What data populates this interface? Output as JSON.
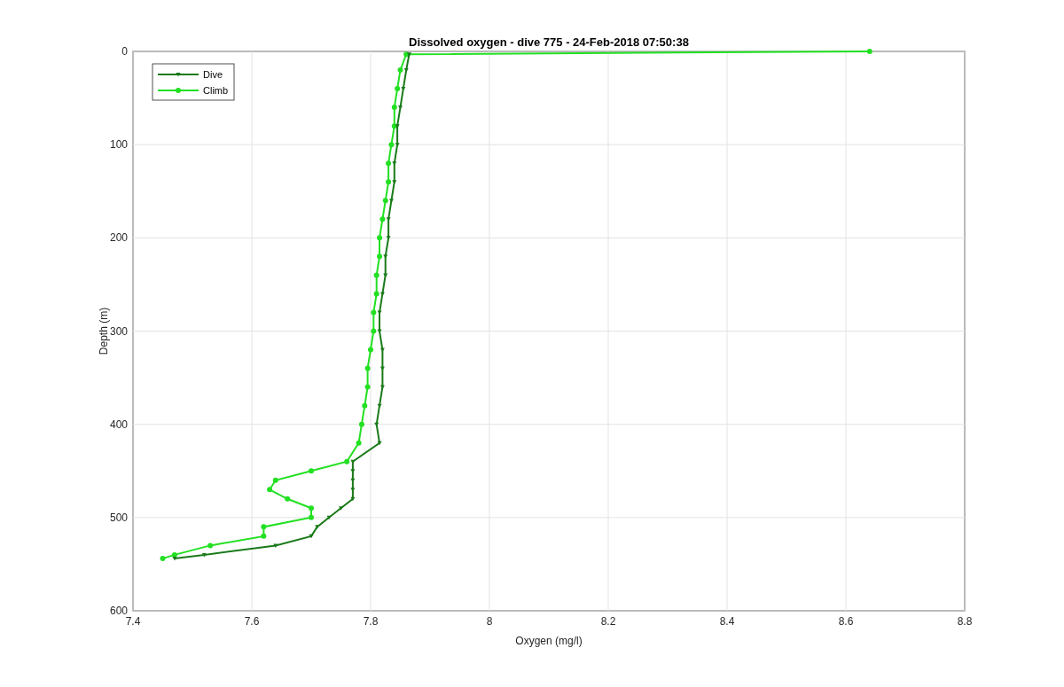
{
  "chart_data": {
    "type": "line",
    "orientation": "horizontal",
    "title": "Dissolved oxygen - dive 775 - 24-Feb-2018 07:50:38",
    "xlabel": "Oxygen (mg/l)",
    "ylabel": "Depth (m)",
    "x": [
      0,
      3,
      20,
      40,
      60,
      80,
      100,
      120,
      140,
      160,
      180,
      200,
      220,
      240,
      260,
      280,
      300,
      320,
      340,
      360,
      380,
      400,
      420,
      440,
      450,
      460,
      470,
      480,
      490,
      500,
      510,
      520,
      530,
      540,
      544
    ],
    "series": [
      {
        "name": "Dive",
        "color": "#1a7a1a",
        "marker": "triangle",
        "values": [
          null,
          7.865,
          7.86,
          7.855,
          7.85,
          7.845,
          7.845,
          7.84,
          7.84,
          7.835,
          7.83,
          7.83,
          7.825,
          7.825,
          7.82,
          7.815,
          7.815,
          7.82,
          7.82,
          7.82,
          7.815,
          7.81,
          7.815,
          7.77,
          7.77,
          7.77,
          7.77,
          7.77,
          7.75,
          7.73,
          7.71,
          7.7,
          7.64,
          7.52,
          7.47
        ]
      },
      {
        "name": "Climb",
        "color": "#22e022",
        "marker": "circle",
        "values": [
          8.64,
          7.86,
          7.85,
          7.845,
          7.84,
          7.84,
          7.835,
          7.83,
          7.83,
          7.825,
          7.82,
          7.815,
          7.815,
          7.81,
          7.81,
          7.805,
          7.805,
          7.8,
          7.795,
          7.795,
          7.79,
          7.785,
          7.78,
          7.76,
          7.7,
          7.64,
          7.63,
          7.66,
          7.7,
          7.7,
          7.62,
          7.62,
          7.53,
          7.47,
          7.45
        ]
      }
    ],
    "xlim": [
      7.4,
      8.8
    ],
    "ylim": [
      600,
      0
    ],
    "xticks": [
      7.4,
      7.6,
      7.8,
      8,
      8.2,
      8.4,
      8.6,
      8.8
    ],
    "yticks": [
      0,
      100,
      200,
      300,
      400,
      500,
      600
    ],
    "grid": true,
    "legend": true
  }
}
